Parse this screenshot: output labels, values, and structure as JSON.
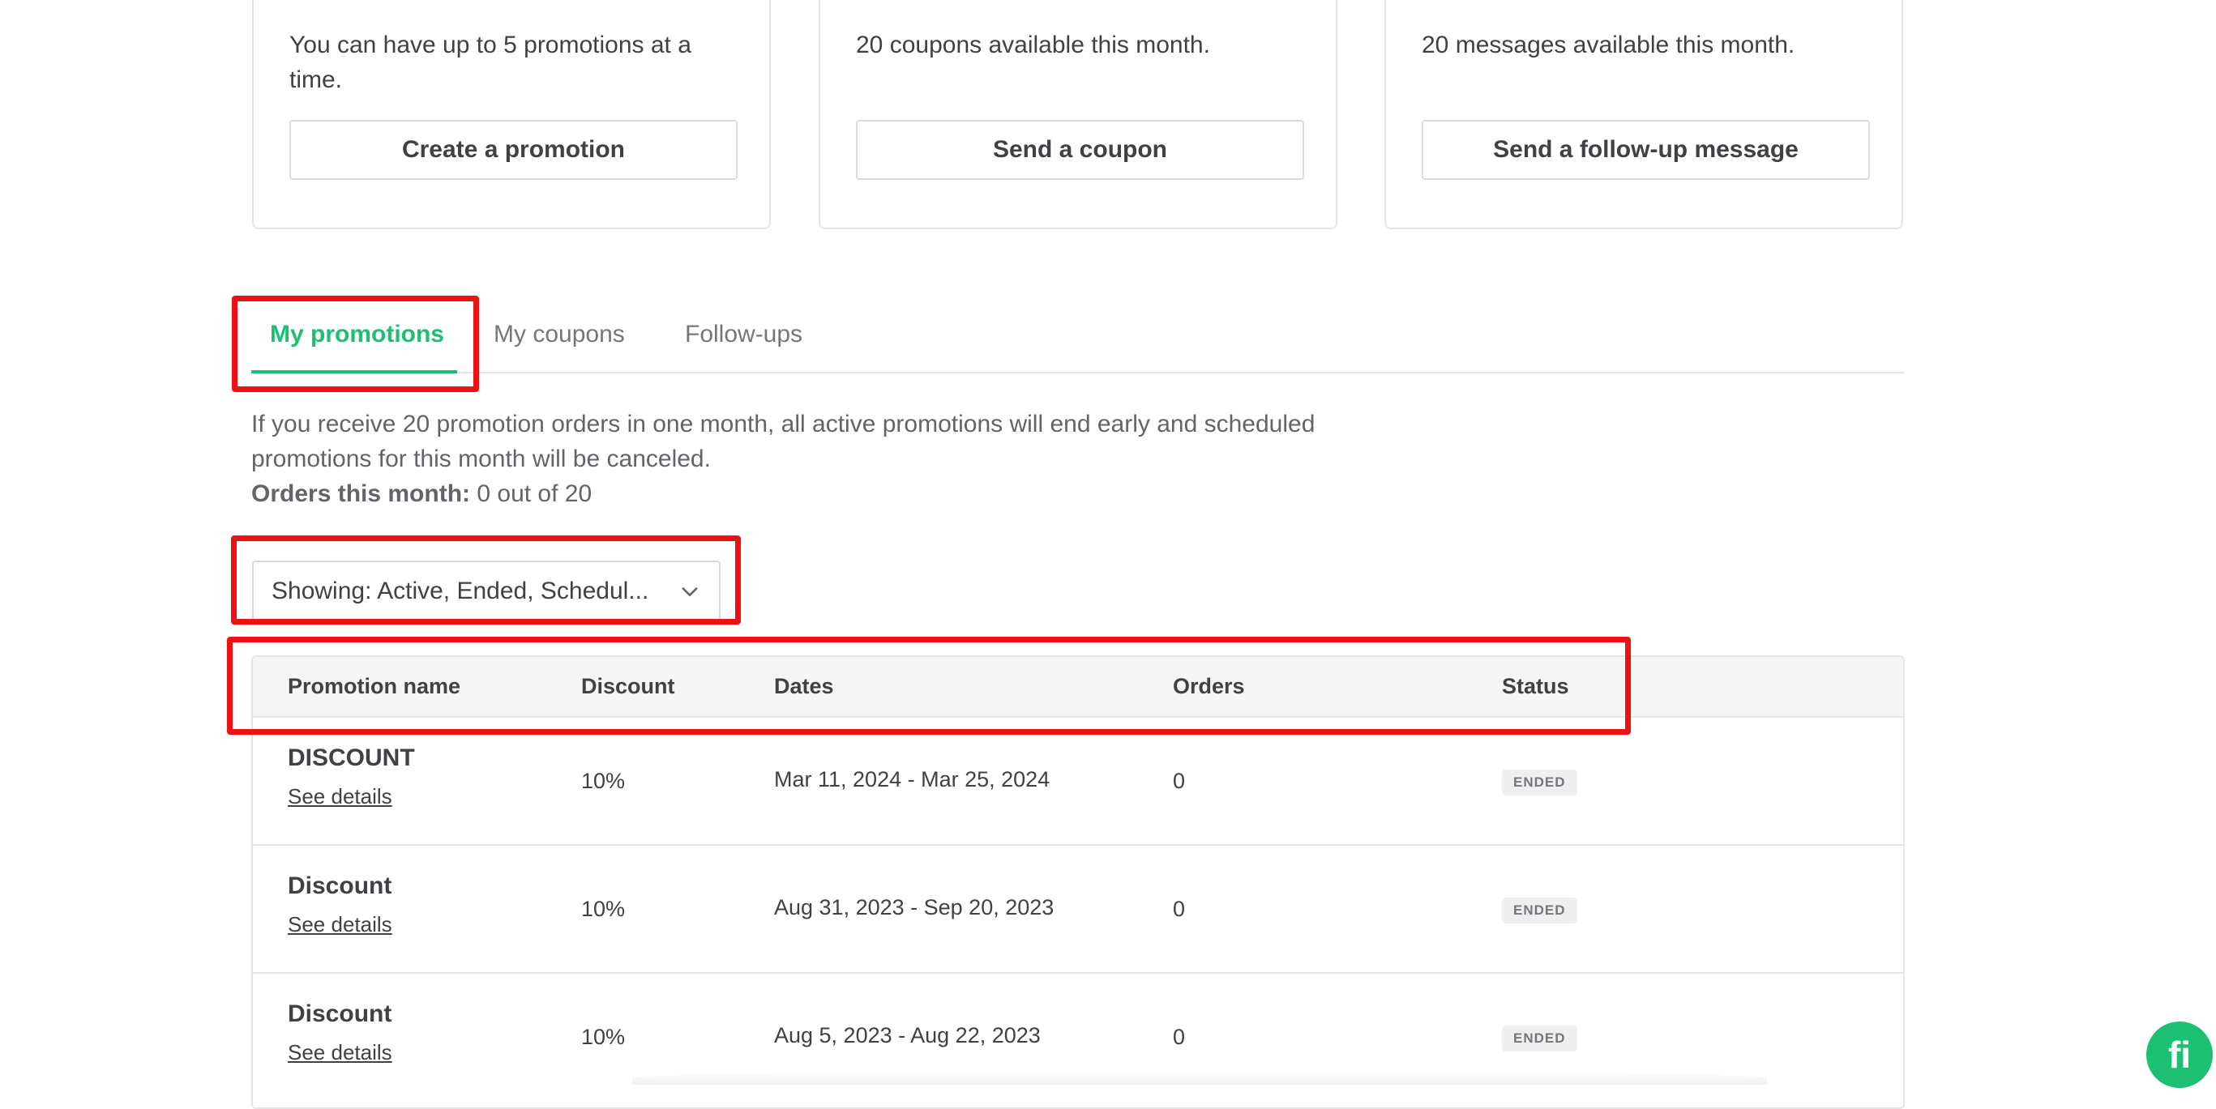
{
  "cards": [
    {
      "desc": "You can have up to 5 promotions at a time.",
      "button": "Create a promotion"
    },
    {
      "desc": "20 coupons available this month.",
      "button": "Send a coupon"
    },
    {
      "desc": "20 messages available this month.",
      "button": "Send a follow-up message"
    }
  ],
  "tabs": [
    "My promotions",
    "My coupons",
    "Follow-ups"
  ],
  "info": {
    "text": "If you receive 20 promotion orders in one month, all active promotions will end early and scheduled promotions for this month will be canceled.",
    "orders_label": "Orders this month:",
    "orders_value": "0 out of 20"
  },
  "filter": {
    "label": "Showing: Active, Ended, Schedul..."
  },
  "table": {
    "headers": [
      "Promotion name",
      "Discount",
      "Dates",
      "Orders",
      "Status"
    ],
    "rows": [
      {
        "name": "DISCOUNT",
        "link": "See details",
        "discount": "10%",
        "dates": "Mar 11, 2024 - Mar 25, 2024",
        "orders": "0",
        "status": "ENDED"
      },
      {
        "name": "Discount",
        "link": "See details",
        "discount": "10%",
        "dates": "Aug 31, 2023 - Sep 20, 2023",
        "orders": "0",
        "status": "ENDED"
      },
      {
        "name": "Discount",
        "link": "See details",
        "discount": "10%",
        "dates": "Aug 5, 2023 - Aug 22, 2023",
        "orders": "0",
        "status": "ENDED"
      }
    ]
  },
  "fab": {
    "label": "fi"
  },
  "colors": {
    "accent": "#1dbf73",
    "highlight": "#ee1111"
  }
}
